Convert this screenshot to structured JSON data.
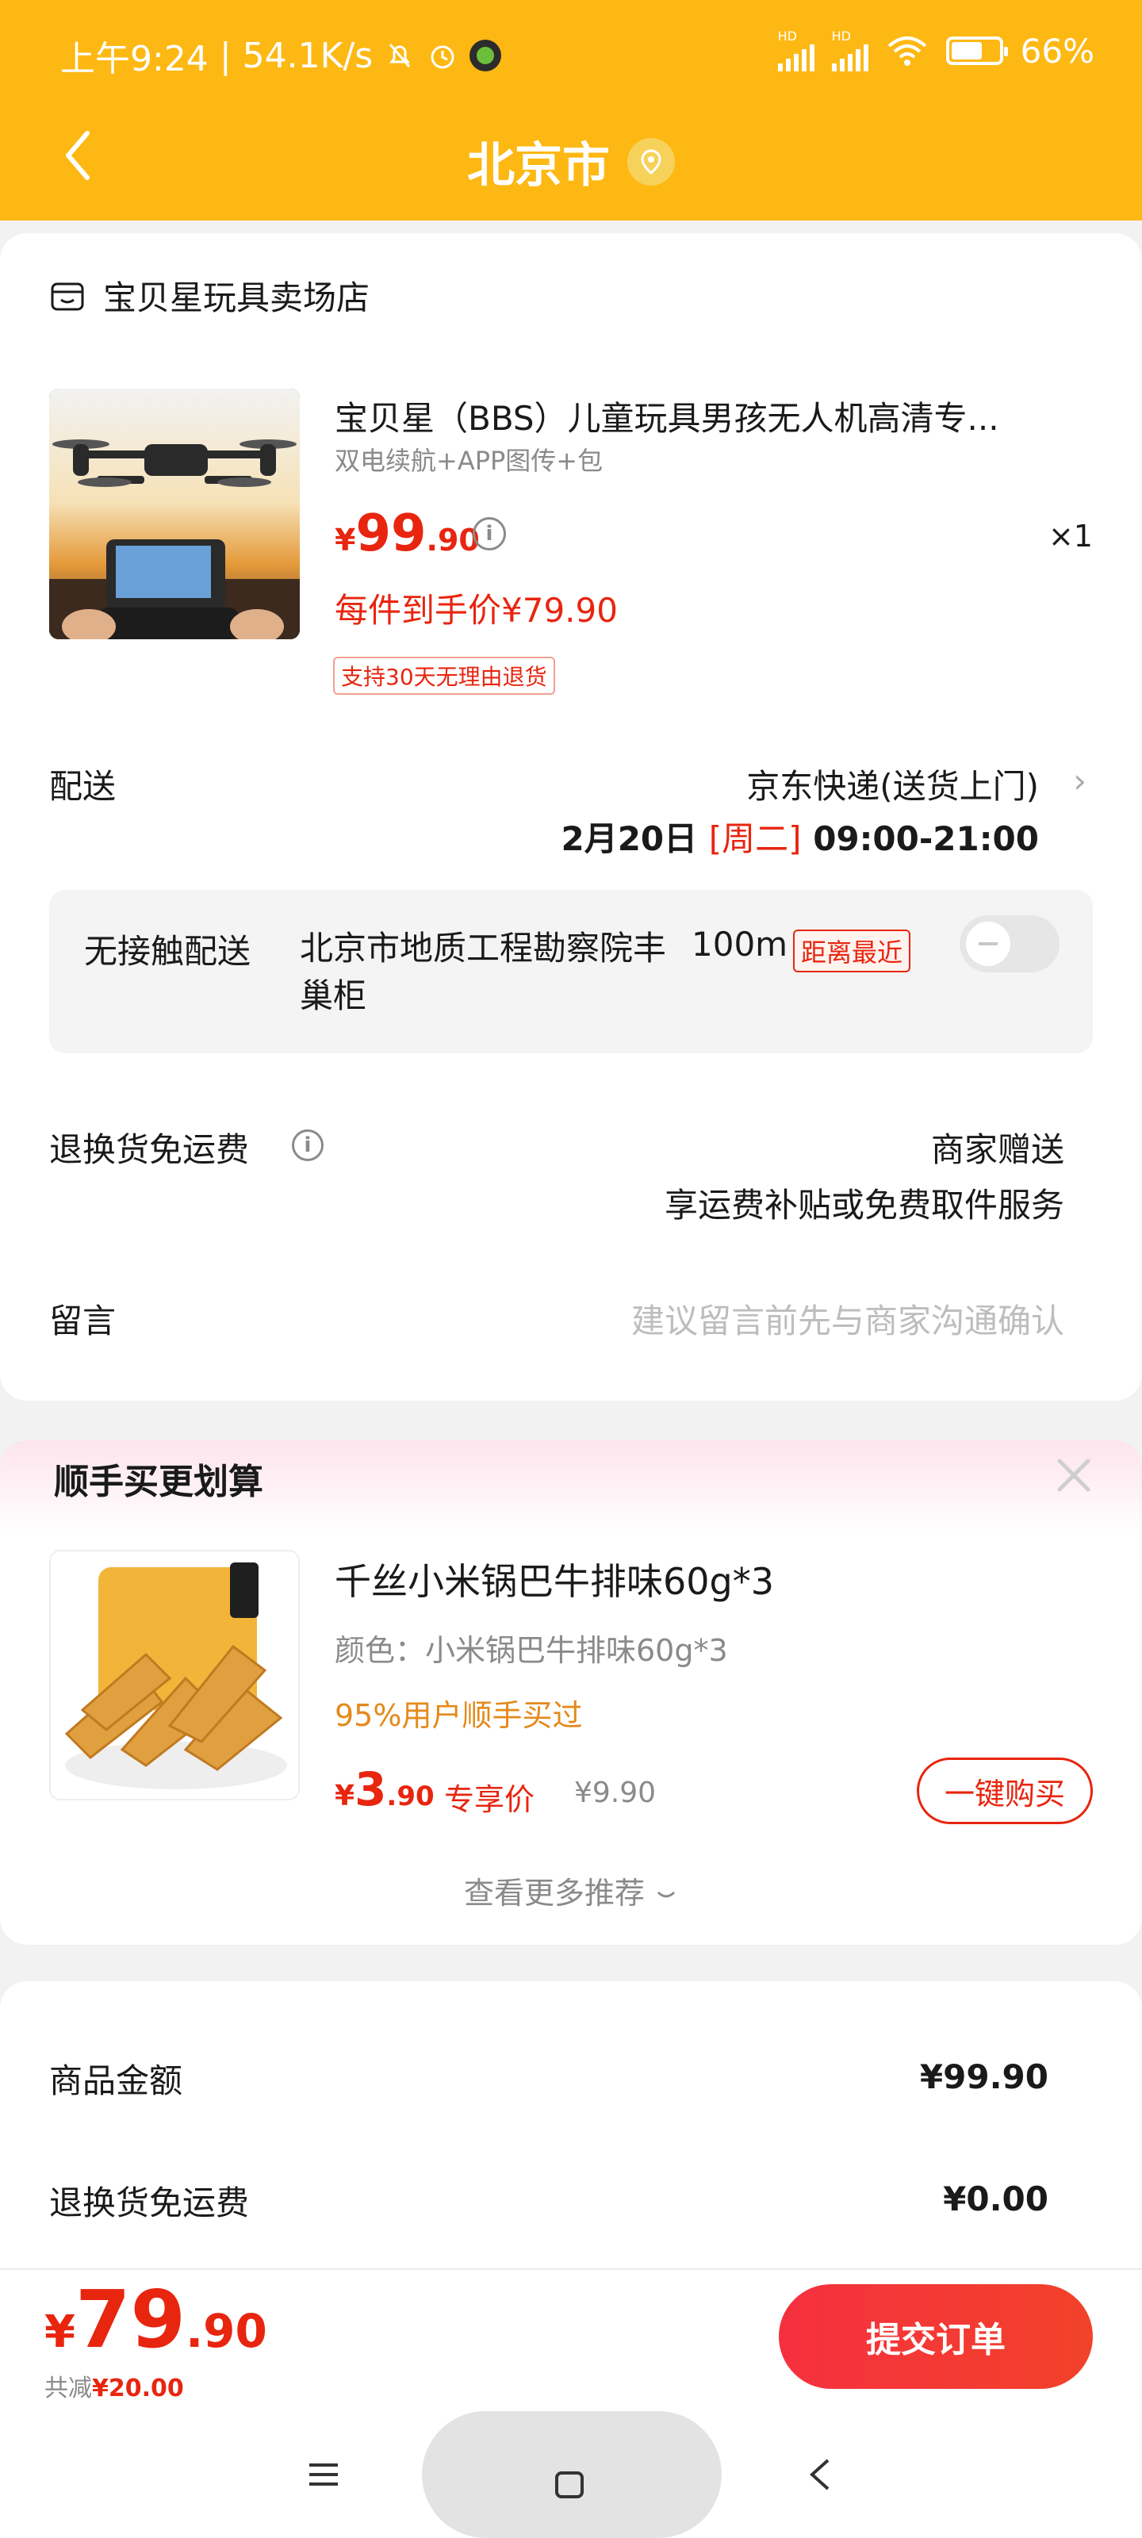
{
  "status_bar": {
    "time": "上午9:24",
    "network_speed": "54.1K/s",
    "signal_1_label": "HD",
    "signal_2_label": "HD",
    "battery": "66%",
    "icons": [
      "bell-muted-icon",
      "alarm-icon",
      "wechat-icon",
      "signal-icon",
      "wifi-icon",
      "battery-icon"
    ]
  },
  "nav": {
    "title": "北京市",
    "back_icon": "chevron-left-icon",
    "location_icon": "location-pin-icon"
  },
  "order": {
    "store_name": "宝贝星玩具卖场店",
    "product": {
      "title": "宝贝星（BBS）儿童玩具男孩无人机高清专...",
      "spec": "双电续航+APP图传+包",
      "price_currency": "¥",
      "price_int": "99",
      "price_dec": ".90",
      "quantity": "×1",
      "final_price": "每件到手价¥79.90",
      "return_tag": "支持30天无理由退货"
    },
    "shipping": {
      "label": "配送",
      "carrier": "京东快递(送货上门)",
      "date": "2月20日",
      "weekday": "[周二]",
      "time": "09:00-21:00"
    },
    "contactless": {
      "label": "无接触配送",
      "address": "北京市地质工程勘察院丰巢柜",
      "distance": "100m",
      "tag": "距离最近",
      "enabled": false
    },
    "exchange": {
      "label": "退换货免运费",
      "value": "商家赠送",
      "desc": "享运费补贴或免费取件服务"
    },
    "message": {
      "label": "留言",
      "placeholder": "建议留言前先与商家沟通确认"
    }
  },
  "recommend": {
    "title": "顺手买更划算",
    "item": {
      "name": "千丝小米锅巴牛排味60g*3",
      "color": "颜色：小米锅巴牛排味60g*3",
      "bought": "95%用户顺手买过",
      "price_currency": "¥",
      "price_int": "3",
      "price_dec": ".90",
      "exclusive": "专享价",
      "original_price": "¥9.90",
      "buy_label": "一键购买"
    },
    "more": "查看更多推荐"
  },
  "summary": {
    "items_label": "商品金额",
    "items_value": "¥99.90",
    "exchange_label": "退换货免运费",
    "exchange_value": "¥0.00"
  },
  "bottom": {
    "total_currency": "¥",
    "total_int": "79",
    "total_dec": ".90",
    "discount_label": "共减",
    "discount_amount": "¥20.00",
    "submit_label": "提交订单"
  },
  "colors": {
    "header": "#fdb813",
    "accent_red": "#e8250f",
    "orange_text": "#e48a1a"
  }
}
